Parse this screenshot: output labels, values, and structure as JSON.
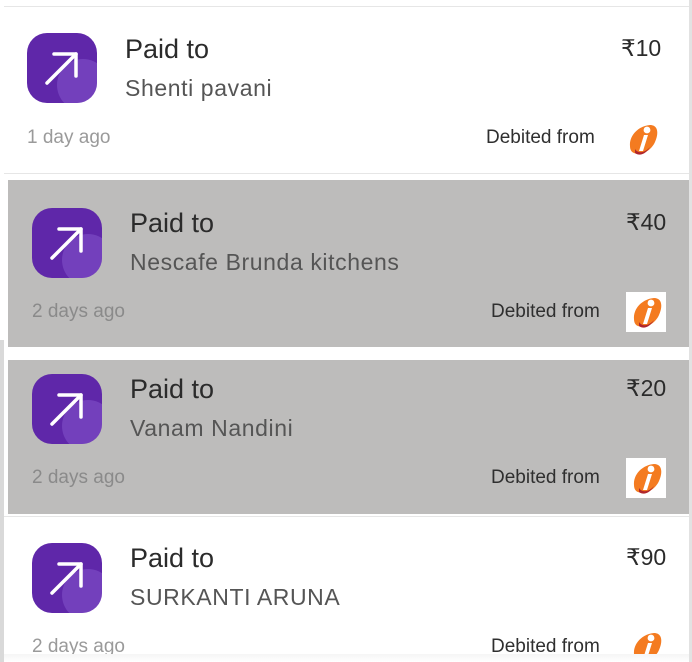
{
  "transactions": [
    {
      "title": "Paid to",
      "name": "Shenti pavani",
      "amount": "₹10",
      "time": "1 day ago",
      "debited_label": "Debited from",
      "direction_icon": "arrow-up-right-icon",
      "bank_icon": "icici-bank-logo",
      "highlighted": false
    },
    {
      "title": "Paid to",
      "name": "Nescafe Brunda kitchens",
      "amount": "₹40",
      "time": "2 days ago",
      "debited_label": "Debited from",
      "direction_icon": "arrow-up-right-icon",
      "bank_icon": "icici-bank-logo",
      "highlighted": true
    },
    {
      "title": "Paid to",
      "name": "Vanam Nandini",
      "amount": "₹20",
      "time": "2 days ago",
      "debited_label": "Debited from",
      "direction_icon": "arrow-up-right-icon",
      "bank_icon": "icici-bank-logo",
      "highlighted": true
    },
    {
      "title": "Paid to",
      "name": "SURKANTI ARUNA",
      "amount": "₹90",
      "time": "2 days ago",
      "debited_label": "Debited from",
      "direction_icon": "arrow-up-right-icon",
      "bank_icon": "icici-bank-logo",
      "highlighted": false
    }
  ],
  "colors": {
    "icon_tile": "#5f27a9",
    "highlight_bg": "#bdbcbb",
    "bank_orange": "#f47b20",
    "bank_red": "#b0262c"
  }
}
